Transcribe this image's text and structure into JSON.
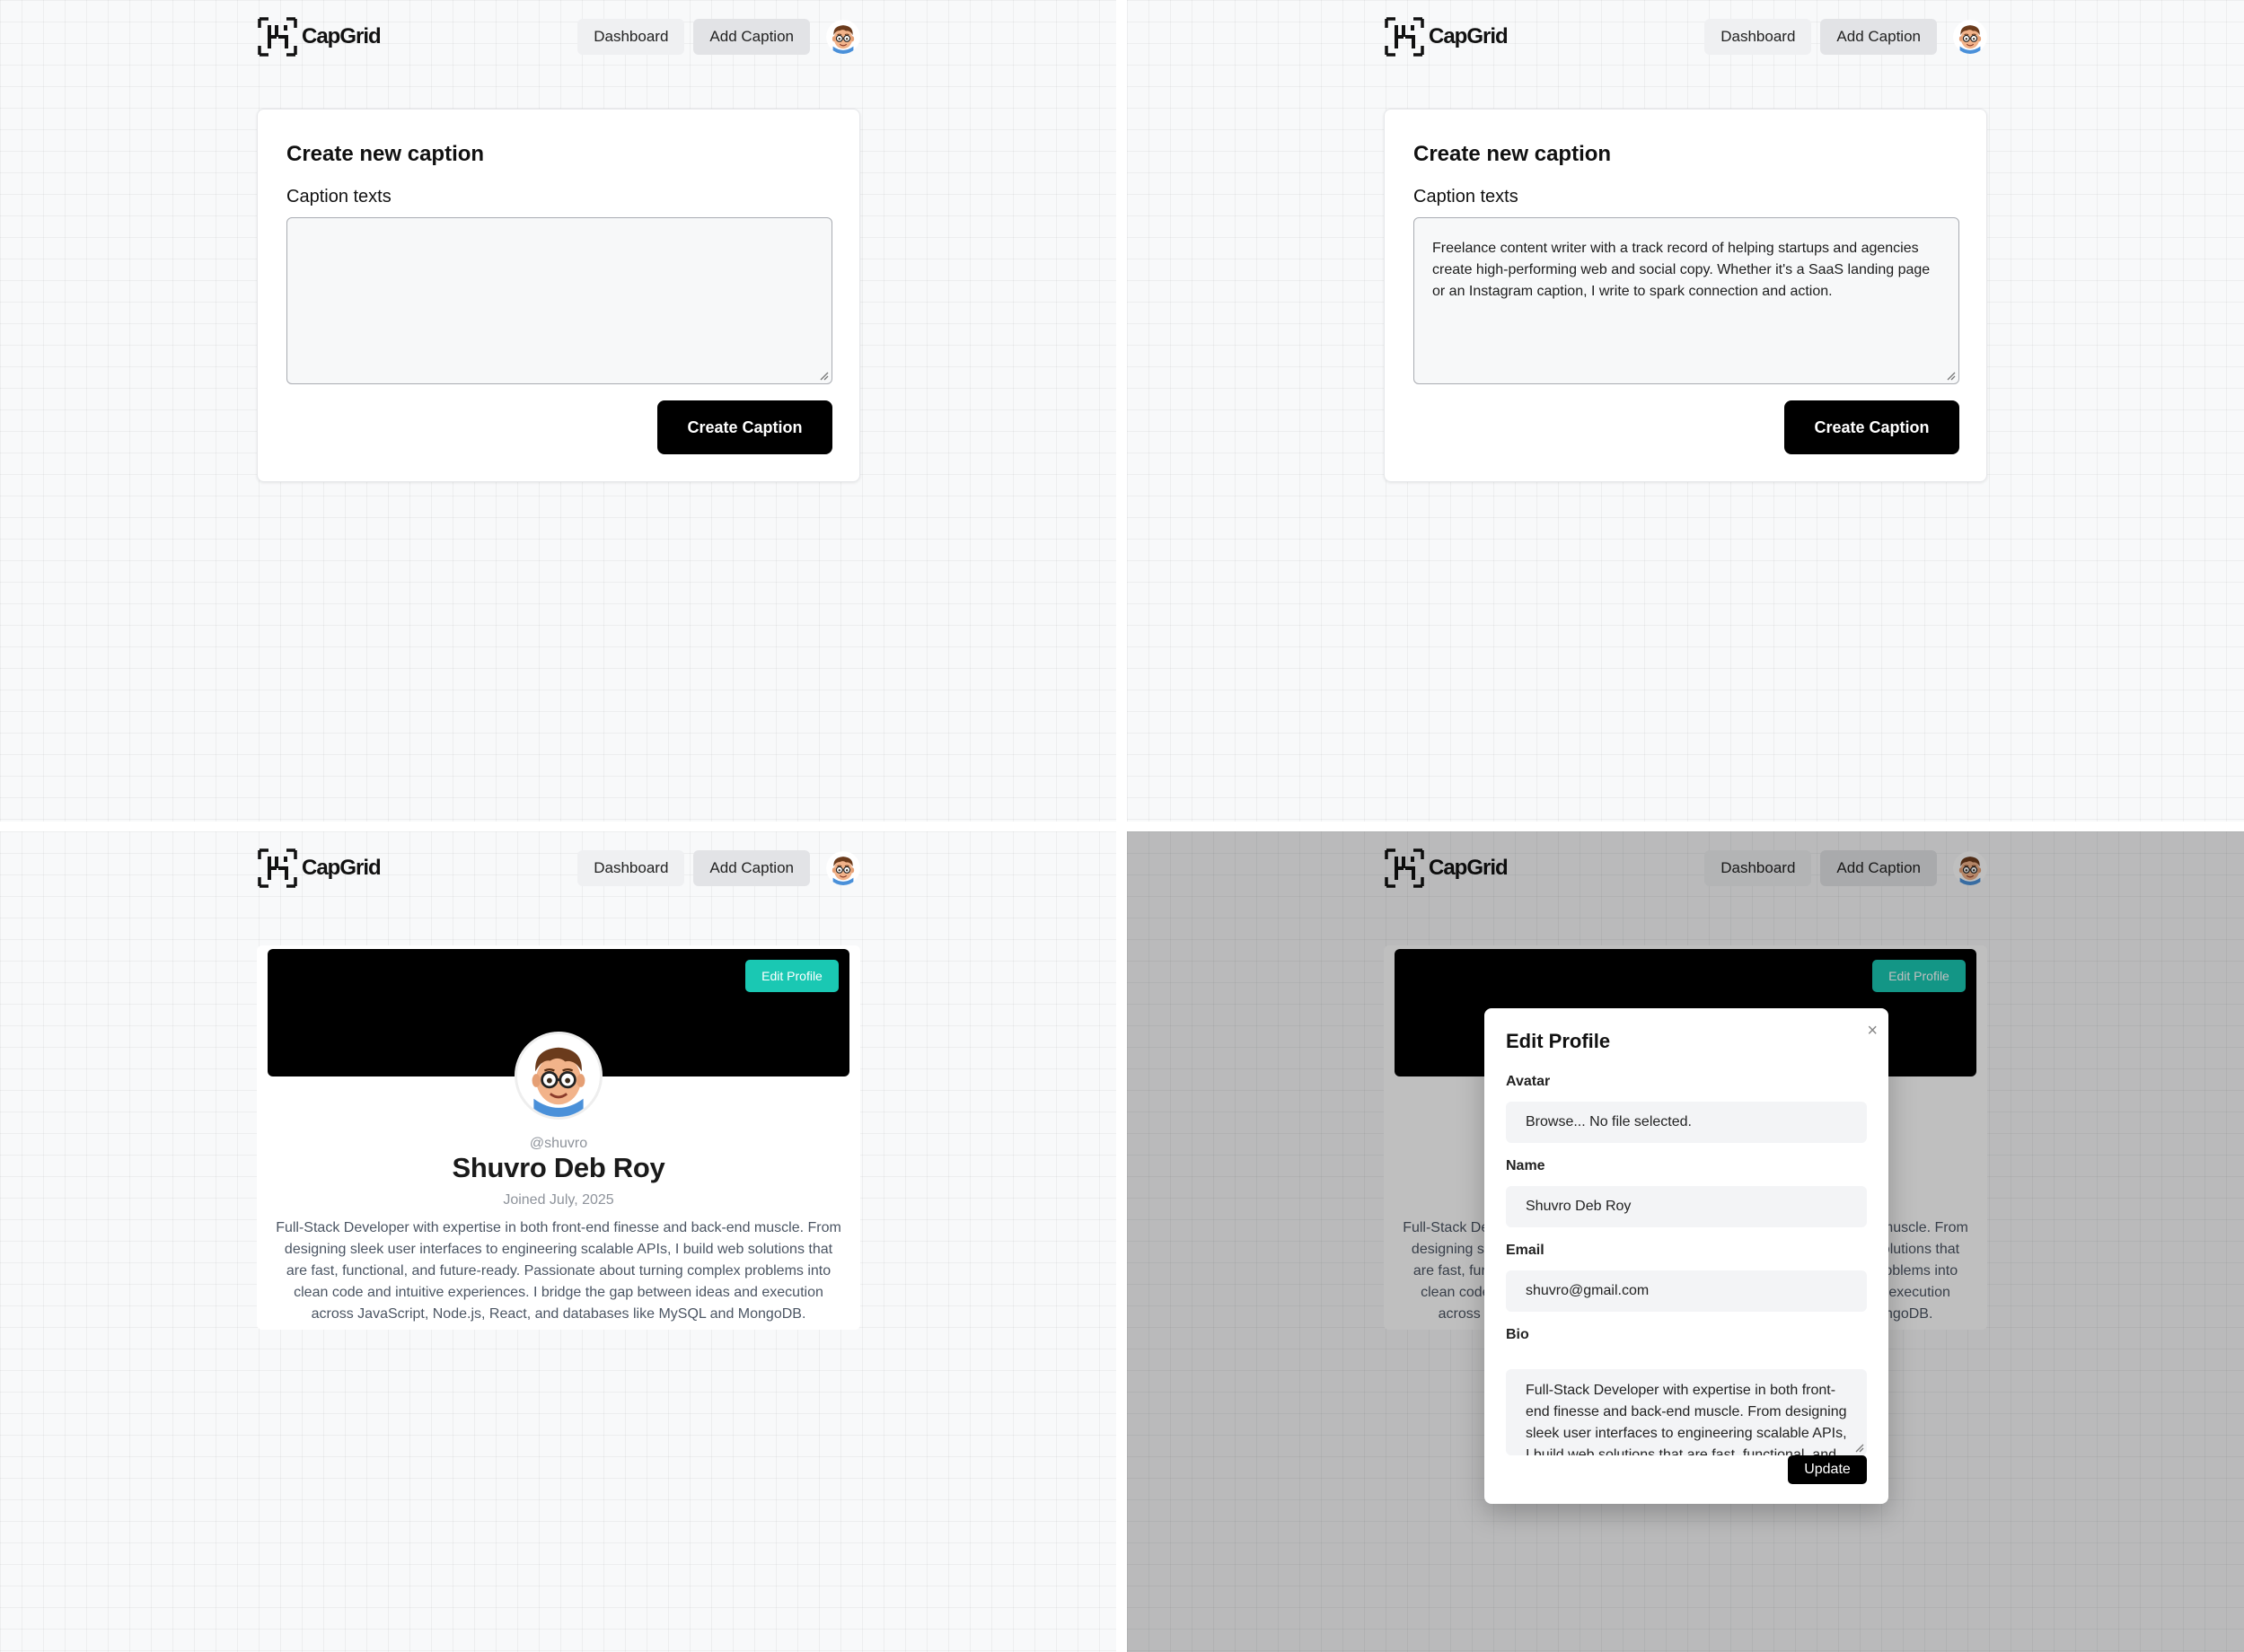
{
  "brand": {
    "name": "CapGrid",
    "logo_icon": "capgrid-logo-icon"
  },
  "nav": {
    "dashboard": "Dashboard",
    "add_caption": "Add Caption",
    "avatar_icon": "user-avatar-icon"
  },
  "create_caption": {
    "title": "Create new caption",
    "label": "Caption texts",
    "button": "Create Caption",
    "filled_text": "Freelance content writer with a track record of helping startups and agencies create high-performing web and social copy. Whether it's a SaaS landing page or an Instagram caption, I write to spark connection and action."
  },
  "profile": {
    "edit_button": "Edit Profile",
    "handle": "@shuvro",
    "name": "Shuvro Deb Roy",
    "joined": "Joined July, 2025",
    "bio": "Full-Stack Developer with expertise in both front-end finesse and back-end muscle. From designing sleek user interfaces to engineering scalable APIs, I build web solutions that are fast, functional, and future-ready. Passionate about turning complex problems into clean code and intuitive experiences. I bridge the gap between ideas and execution across JavaScript, Node.js, React, and databases like MySQL and MongoDB."
  },
  "edit_modal": {
    "title": "Edit Profile",
    "close": "×",
    "avatar_label": "Avatar",
    "avatar_value": "Browse... No file selected.",
    "name_label": "Name",
    "name_value": "Shuvro Deb Roy",
    "email_label": "Email",
    "email_value": "shuvro@gmail.com",
    "bio_label": "Bio",
    "update_button": "Update"
  },
  "colors": {
    "accent": "#1ac8b3",
    "primary": "#000000",
    "grid_bg": "#f8f9fa"
  }
}
